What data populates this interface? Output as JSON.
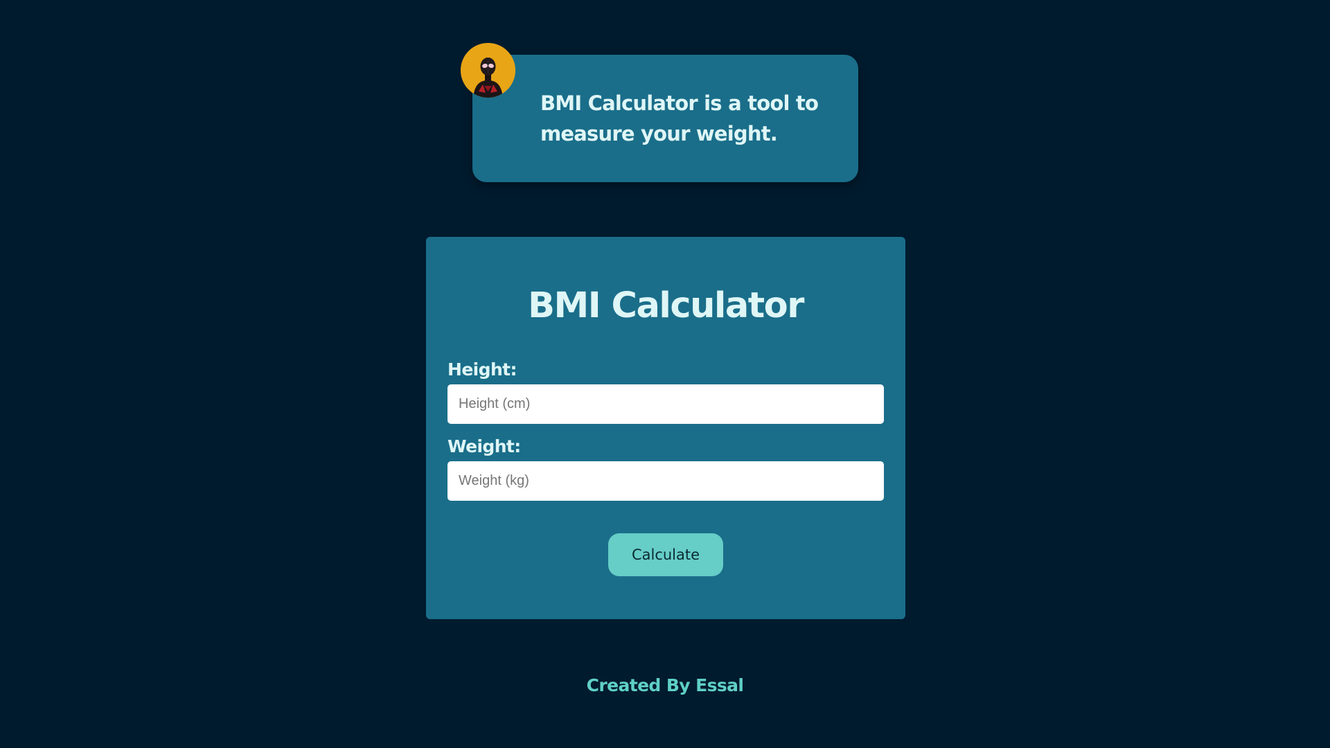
{
  "intro": {
    "avatar_icon": "spider-hero-avatar",
    "text": "BMI Calculator is a tool to measure your weight."
  },
  "calculator": {
    "title": "BMI Calculator",
    "height_label": "Height:",
    "height_placeholder": "Height (cm)",
    "height_value": "",
    "weight_label": "Weight:",
    "weight_placeholder": "Weight (kg)",
    "weight_value": "",
    "button_label": "Calculate"
  },
  "footer": {
    "text": "Created By Essal"
  },
  "colors": {
    "background": "#001b2e",
    "card": "#1a6e8a",
    "text_light": "#dff6f6",
    "button": "#66cdc7",
    "footer_text": "#5fd0c7",
    "avatar_bg": "#e8a516"
  }
}
